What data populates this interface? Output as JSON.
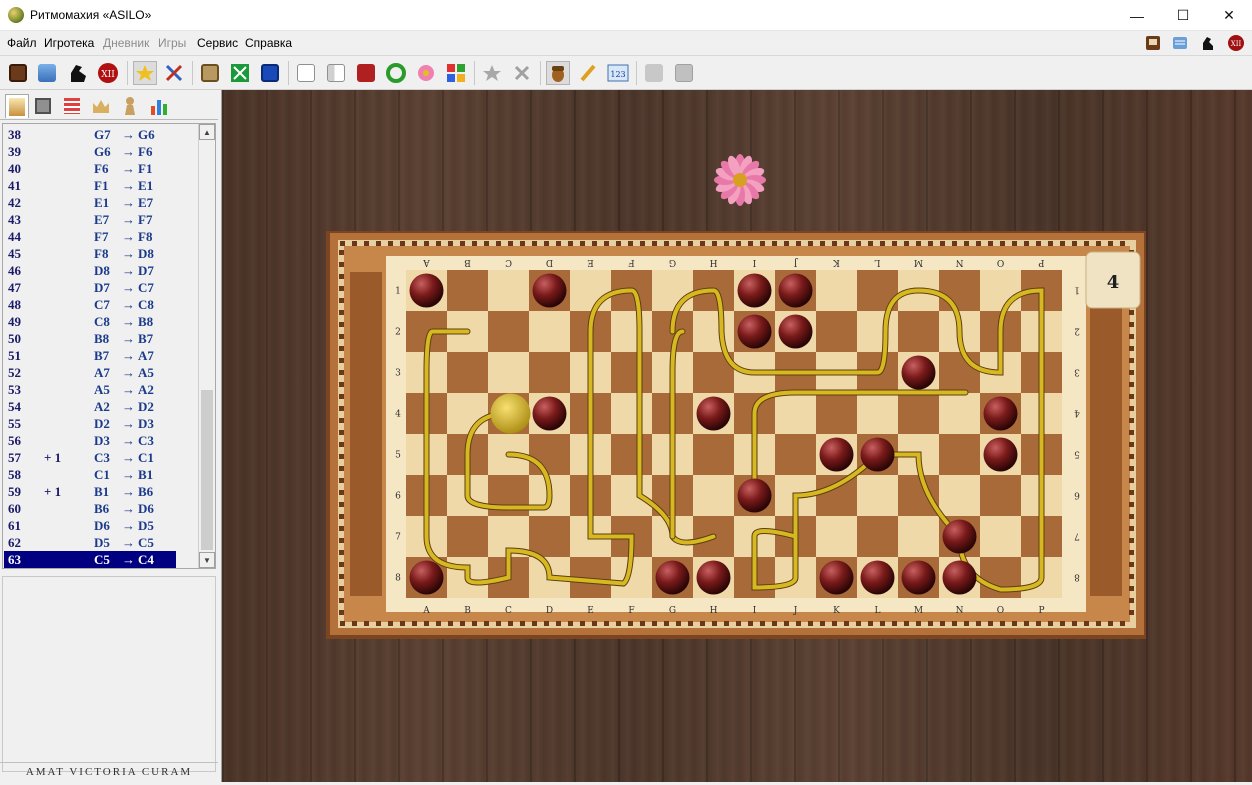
{
  "window": {
    "title": "Ритмомахия «ASILO»",
    "minimize": "—",
    "maximize": "☐",
    "close": "✕"
  },
  "menu": {
    "items": [
      {
        "label": "Файл",
        "enabled": true
      },
      {
        "label": "Игротека",
        "enabled": true
      },
      {
        "label": "Дневник",
        "enabled": false
      },
      {
        "label": "Игры",
        "enabled": false
      },
      {
        "label": "Сервис",
        "enabled": true
      },
      {
        "label": "Справка",
        "enabled": true
      }
    ],
    "right_icons": [
      "clock-icon",
      "scroll-icon",
      "horse-icon",
      "roman-xii-icon"
    ],
    "xii_label": "XII"
  },
  "toolbar": {
    "icons": [
      "clock-icon",
      "scroll-icon",
      "horse-icon",
      "roman-xii-icon",
      "star-icon",
      "tools-icon",
      "board-icon",
      "fullscreen-icon",
      "window-icon",
      "document-icon",
      "panel-icon",
      "abc-book-icon",
      "refresh-icon",
      "flower-icon",
      "calculator-icon",
      "star-outline-icon",
      "close-icon",
      "acorn-icon",
      "pencil-icon",
      "counter-123-icon",
      "open-folder-icon",
      "save-icon"
    ],
    "xii_label": "XII",
    "counter_label": "123"
  },
  "side_tabs": [
    "candle-icon",
    "calculator-icon",
    "table-icon",
    "crown-icon",
    "pawn-icon",
    "bar-chart-icon"
  ],
  "moves": [
    {
      "num": "38",
      "bonus": "",
      "from": "G7",
      "to": "G6"
    },
    {
      "num": "39",
      "bonus": "",
      "from": "G6",
      "to": "F6"
    },
    {
      "num": "40",
      "bonus": "",
      "from": "F6",
      "to": "F1"
    },
    {
      "num": "41",
      "bonus": "",
      "from": "F1",
      "to": "E1"
    },
    {
      "num": "42",
      "bonus": "",
      "from": "E1",
      "to": "E7"
    },
    {
      "num": "43",
      "bonus": "",
      "from": "E7",
      "to": "F7"
    },
    {
      "num": "44",
      "bonus": "",
      "from": "F7",
      "to": "F8"
    },
    {
      "num": "45",
      "bonus": "",
      "from": "F8",
      "to": "D8"
    },
    {
      "num": "46",
      "bonus": "",
      "from": "D8",
      "to": "D7"
    },
    {
      "num": "47",
      "bonus": "",
      "from": "D7",
      "to": "C7"
    },
    {
      "num": "48",
      "bonus": "",
      "from": "C7",
      "to": "C8"
    },
    {
      "num": "49",
      "bonus": "",
      "from": "C8",
      "to": "B8"
    },
    {
      "num": "50",
      "bonus": "",
      "from": "B8",
      "to": "B7"
    },
    {
      "num": "51",
      "bonus": "",
      "from": "B7",
      "to": "A7"
    },
    {
      "num": "52",
      "bonus": "",
      "from": "A7",
      "to": "A5"
    },
    {
      "num": "53",
      "bonus": "",
      "from": "A5",
      "to": "A2"
    },
    {
      "num": "54",
      "bonus": "",
      "from": "A2",
      "to": "D2"
    },
    {
      "num": "55",
      "bonus": "",
      "from": "D2",
      "to": "D3"
    },
    {
      "num": "56",
      "bonus": "",
      "from": "D3",
      "to": "C3"
    },
    {
      "num": "57",
      "bonus": "+ 1",
      "from": "C3",
      "to": "C1"
    },
    {
      "num": "58",
      "bonus": "",
      "from": "C1",
      "to": "B1"
    },
    {
      "num": "59",
      "bonus": "+ 1",
      "from": "B1",
      "to": "B6"
    },
    {
      "num": "60",
      "bonus": "",
      "from": "B6",
      "to": "D6"
    },
    {
      "num": "61",
      "bonus": "",
      "from": "D6",
      "to": "D5"
    },
    {
      "num": "62",
      "bonus": "",
      "from": "D5",
      "to": "C5"
    },
    {
      "num": "63",
      "bonus": "",
      "from": "C5",
      "to": "C4",
      "selected": true
    }
  ],
  "arrow_glyph": "→",
  "motto": "AMAT VICTORIA CURAM",
  "board": {
    "files": [
      "A",
      "B",
      "C",
      "D",
      "E",
      "F",
      "G",
      "H",
      "I",
      "J",
      "K",
      "L",
      "M",
      "N",
      "O",
      "P"
    ],
    "ranks": [
      "1",
      "2",
      "3",
      "4",
      "5",
      "6",
      "7",
      "8"
    ],
    "counter": "4",
    "balls": [
      {
        "col": 0,
        "row": 0
      },
      {
        "col": 3,
        "row": 0
      },
      {
        "col": 8,
        "row": 0
      },
      {
        "col": 9,
        "row": 0
      },
      {
        "col": 8,
        "row": 1
      },
      {
        "col": 9,
        "row": 1
      },
      {
        "col": 12,
        "row": 2
      },
      {
        "col": 3,
        "row": 3
      },
      {
        "col": 7,
        "row": 3
      },
      {
        "col": 14,
        "row": 3
      },
      {
        "col": 10,
        "row": 4
      },
      {
        "col": 11,
        "row": 4
      },
      {
        "col": 14,
        "row": 4
      },
      {
        "col": 8,
        "row": 5
      },
      {
        "col": 13,
        "row": 6
      },
      {
        "col": 0,
        "row": 7
      },
      {
        "col": 6,
        "row": 7
      },
      {
        "col": 7,
        "row": 7
      },
      {
        "col": 10,
        "row": 7
      },
      {
        "col": 11,
        "row": 7
      },
      {
        "col": 12,
        "row": 7
      },
      {
        "col": 13,
        "row": 7
      }
    ],
    "yarn": {
      "col": 2,
      "row": 3
    },
    "colors": {
      "light": "#f0d9a8",
      "dark": "#a96a3a",
      "ball": "#7a1a1a",
      "rope": "#d8b820",
      "frame": "#b4713a",
      "frame_dark": "#7a4520",
      "counter_bg": "#efe3c4"
    }
  }
}
